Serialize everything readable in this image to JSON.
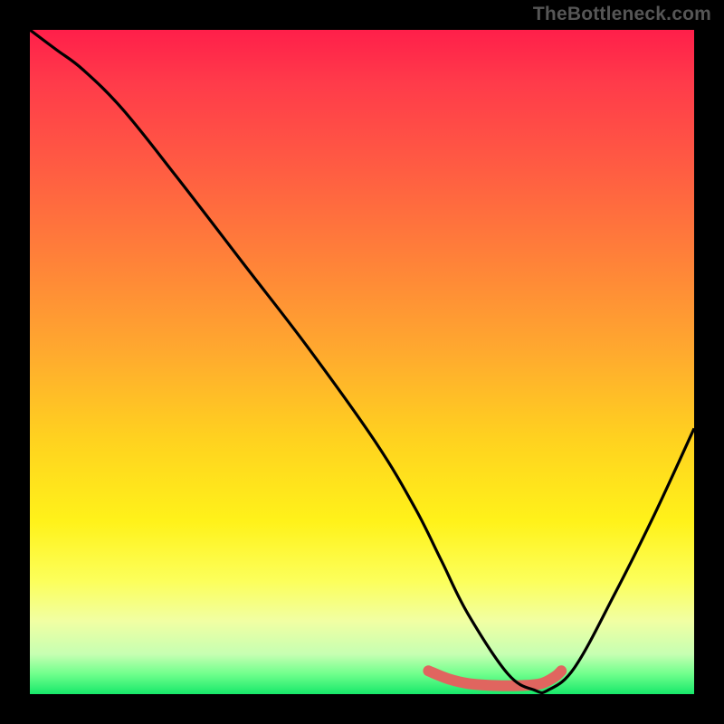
{
  "watermark": "TheBottleneck.com",
  "chart_data": {
    "type": "line",
    "title": "",
    "xlabel": "",
    "ylabel": "",
    "xlim": [
      0,
      100
    ],
    "ylim": [
      0,
      100
    ],
    "series": [
      {
        "name": "curve",
        "x": [
          0,
          4,
          8,
          14,
          22,
          32,
          42,
          52,
          58,
          62,
          66,
          72,
          76,
          78,
          82,
          88,
          94,
          100
        ],
        "values": [
          100,
          97,
          94,
          88,
          78,
          65,
          52,
          38,
          28,
          20,
          12,
          3,
          0.6,
          0.6,
          4,
          15,
          27,
          40
        ]
      }
    ],
    "highlight_segment": {
      "x": [
        60,
        63,
        66,
        70,
        74,
        77,
        79,
        80
      ],
      "values": [
        3.5,
        2.3,
        1.6,
        1.3,
        1.3,
        1.6,
        2.6,
        3.5
      ]
    },
    "background": "rainbow-vertical",
    "grid": false,
    "legend": false
  }
}
